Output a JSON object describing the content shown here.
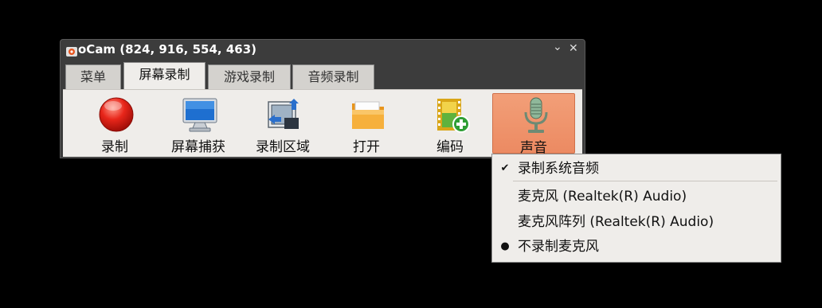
{
  "window": {
    "title": "oCam (824, 916, 554, 463)",
    "minimize_glyph": "⌄",
    "close_glyph": "✕"
  },
  "tabs": [
    {
      "label": "菜单",
      "active": false
    },
    {
      "label": "屏幕录制",
      "active": true
    },
    {
      "label": "游戏录制",
      "active": false
    },
    {
      "label": "音频录制",
      "active": false
    }
  ],
  "toolbar": [
    {
      "label": "录制",
      "icon": "record-icon"
    },
    {
      "label": "屏幕捕获",
      "icon": "monitor-icon"
    },
    {
      "label": "录制区域",
      "icon": "region-icon"
    },
    {
      "label": "打开",
      "icon": "folder-icon"
    },
    {
      "label": "编码",
      "icon": "film-add-icon"
    },
    {
      "label": "声音",
      "icon": "microphone-icon",
      "active": true
    }
  ],
  "sound_menu": {
    "items": [
      {
        "label": "录制系统音频",
        "mark": "✔"
      },
      {
        "label": "麦克风 (Realtek(R) Audio)",
        "mark": ""
      },
      {
        "label": "麦克风阵列 (Realtek(R) Audio)",
        "mark": ""
      },
      {
        "label": "不录制麦克风",
        "mark": "●"
      }
    ]
  },
  "colors": {
    "active_button": "#ec8a62",
    "menu_bg": "#efedea",
    "window_frame": "#3c3c3c"
  }
}
